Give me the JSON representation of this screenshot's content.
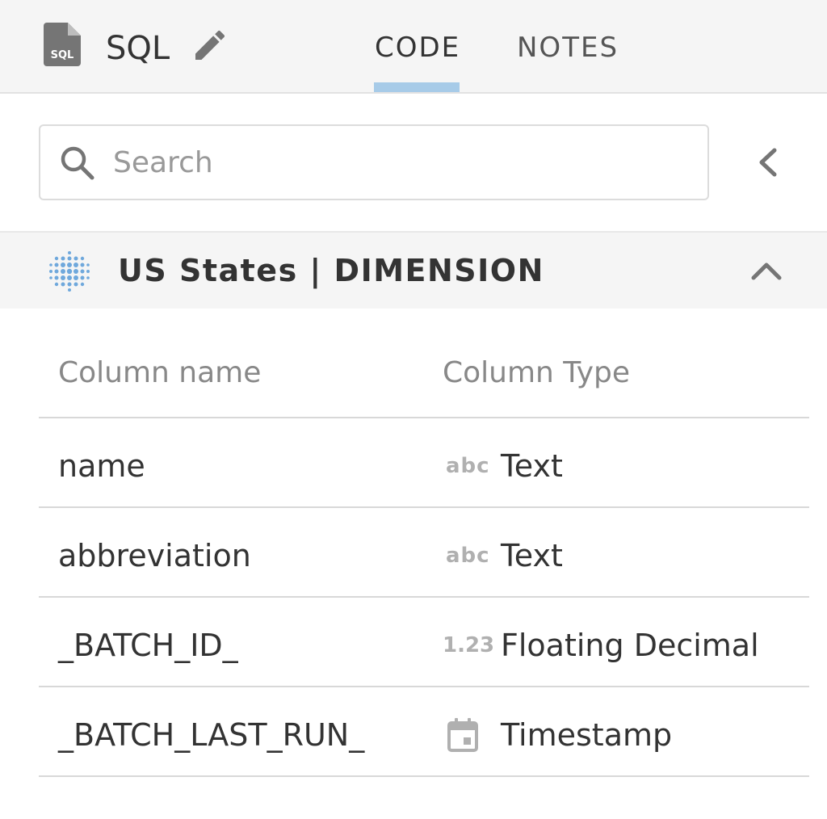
{
  "header": {
    "file_icon": "sql-file-icon",
    "file_icon_text": "SQL",
    "title": "SQL",
    "edit_icon": "pencil-icon",
    "tabs": [
      {
        "label": "CODE",
        "active": true
      },
      {
        "label": "NOTES",
        "active": false
      }
    ],
    "active_tab_color": "#a7cbe8"
  },
  "search": {
    "icon": "search-icon",
    "placeholder": "Search",
    "value": "",
    "collapse_icon": "chevron-left-icon"
  },
  "section": {
    "icon": "dimension-dots-icon",
    "title": "US States | DIMENSION",
    "toggle_icon": "chevron-up-icon",
    "expanded": true
  },
  "table": {
    "headers": {
      "name": "Column name",
      "type": "Column Type"
    },
    "rows": [
      {
        "name": "name",
        "type": "Text",
        "type_icon": "abc-text-icon",
        "type_icon_text": "abc"
      },
      {
        "name": "abbreviation",
        "type": "Text",
        "type_icon": "abc-text-icon",
        "type_icon_text": "abc"
      },
      {
        "name": "_BATCH_ID_",
        "type": "Floating Decimal",
        "type_icon": "decimal-number-icon",
        "type_icon_text": "1.23"
      },
      {
        "name": "_BATCH_LAST_RUN_",
        "type": "Timestamp",
        "type_icon": "calendar-icon",
        "type_icon_text": ""
      }
    ]
  },
  "colors": {
    "header_bg": "#f5f5f5",
    "accent": "#a7cbe8",
    "dimension_blue": "#6fa8dc",
    "muted_text": "#888888"
  }
}
